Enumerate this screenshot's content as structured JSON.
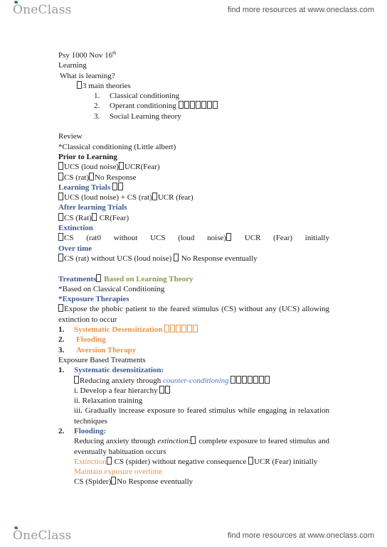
{
  "header": {
    "logo_text": "OneClass",
    "tagline": "find more resources at www.oneclass.com"
  },
  "footer": {
    "logo_text": "OneClass",
    "tagline": "find more resources at www.oneclass.com"
  },
  "doc": {
    "title": "Psy 1000 Nov 16",
    "title_sup": "th",
    "topic": "Learning",
    "question": "What is learning?",
    "theories_intro": "3 main theories",
    "theories": [
      {
        "num": "1.",
        "text": "Classical conditioning"
      },
      {
        "num": "2.",
        "text": "Operant conditioning"
      },
      {
        "num": "3.",
        "text": "Social Learning theory"
      }
    ],
    "review": "Review",
    "review_sub": "*Classical conditioning (Little albert)",
    "prior_heading": "Prior to Learning",
    "prior_lines": [
      "UCS (loud noise)",
      "UCR(Fear)",
      "CS (rat)",
      "No Response"
    ],
    "trials_heading": "Learning Trials",
    "trials_line_a": "UCS (loud noise) + CS (rat)",
    "trials_line_b": "UCR (fear)",
    "after_heading": "After learning Trials",
    "after_line_a": "CS (Rat)",
    "after_line_b": " CR(Fear)",
    "extinction_heading": "Extinction",
    "extinction_words": [
      "CS",
      "(rat0",
      "without",
      "UCS",
      "(loud",
      "noise)",
      "UCR",
      "(Fear)",
      "initially"
    ],
    "overtime_heading": "Over time",
    "overtime_line_a": "CS (rat) without UCS (loud noise) ",
    "overtime_line_b": " No Response eventually",
    "treatments_heading": "Treatments",
    "treatments_sub": " Based on Learning Theory",
    "based_on": "*Based on Classical Conditioning",
    "exposure_heading": "*Exposure Therapies",
    "exposure_text": "Expose the phobic patient to the feared stimulus (CS) without any (UCS) allowing extinction to occur",
    "treatment_list": [
      {
        "num": "1.",
        "text": "Systematic Desensitization"
      },
      {
        "num": "2.",
        "text": "Flooding"
      },
      {
        "num": "3.",
        "text": "Aversion Therapy"
      }
    ],
    "exposure_based": "Exposure Based Treatments",
    "sd_heading_num": "1.",
    "sd_heading": "Systematic desensitization:",
    "sd_reduce_a": "Reducing anxiety through ",
    "sd_reduce_b": "counter-conditioning",
    "sd_steps": [
      "i. Develop a fear hierarchy",
      "ii. Relaxation training",
      "iii. Gradually increase exposure to feared stimulus while engaging in relaxation techniques"
    ],
    "flood_heading_num": "2.",
    "flood_heading": "Flooding:",
    "flood_reduce_a": "Reducing anxiety through ",
    "flood_reduce_b": "extinction:",
    "flood_reduce_c": " complete exposure to feared stimulus and eventually habituation occurs",
    "flood_ext_a": "Extinction",
    "flood_ext_b": " CS (spider) without negative consequence ",
    "flood_ext_c": "UCR (Fear) initially",
    "flood_maintain": "Maintain exposure overtime",
    "flood_final_a": "CS (Spider)",
    "flood_final_b": "No Response eventually"
  }
}
